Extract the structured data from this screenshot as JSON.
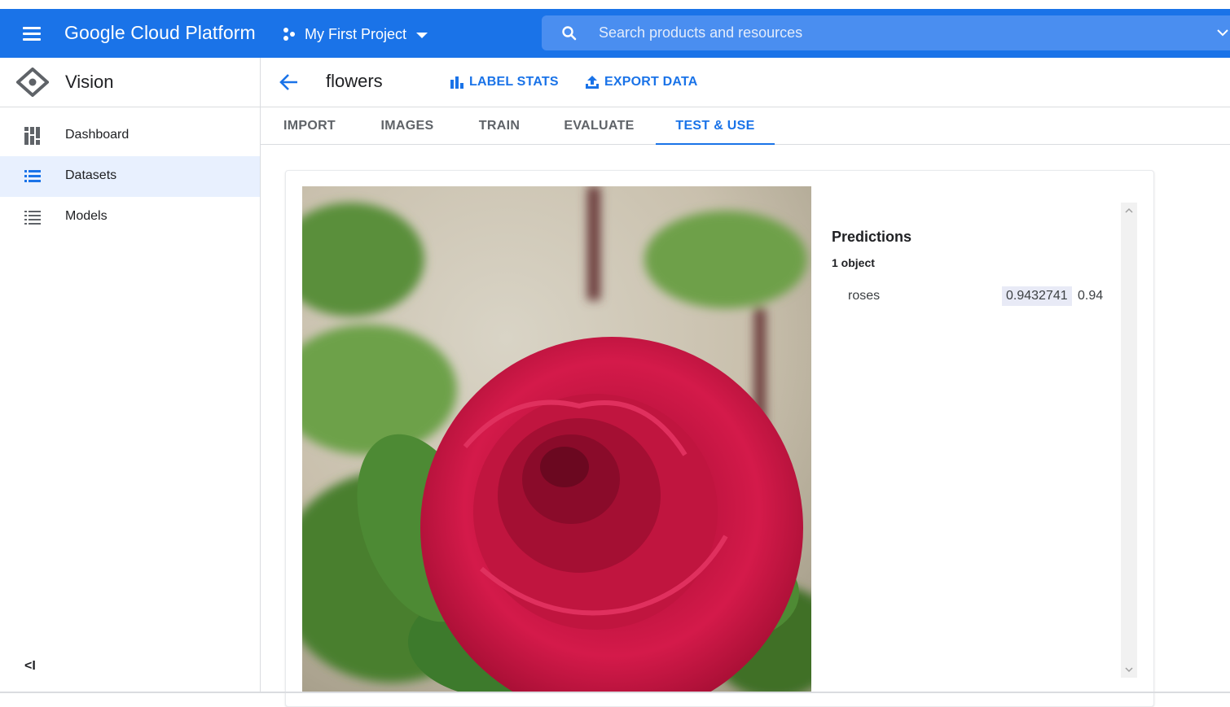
{
  "topbar": {
    "brand": "Google Cloud Platform",
    "project": "My First Project",
    "search_placeholder": "Search products and resources",
    "color": "#1a73e8"
  },
  "sidebar": {
    "product": "Vision",
    "items": [
      {
        "label": "Dashboard",
        "icon": "dashboard-icon",
        "active": false
      },
      {
        "label": "Datasets",
        "icon": "list-icon",
        "active": true
      },
      {
        "label": "Models",
        "icon": "list-icon",
        "active": false
      }
    ],
    "collapse_label": "<I"
  },
  "header": {
    "dataset_name": "flowers",
    "label_stats": "LABEL STATS",
    "export_data": "EXPORT DATA"
  },
  "tabs": [
    {
      "label": "IMPORT",
      "active": false
    },
    {
      "label": "IMAGES",
      "active": false
    },
    {
      "label": "TRAIN",
      "active": false
    },
    {
      "label": "EVALUATE",
      "active": false
    },
    {
      "label": "TEST & USE",
      "active": true
    }
  ],
  "predictions": {
    "title": "Predictions",
    "count": "1 object",
    "items": [
      {
        "label": "roses",
        "raw_score": "0.9432741",
        "score": "0.94"
      }
    ]
  }
}
